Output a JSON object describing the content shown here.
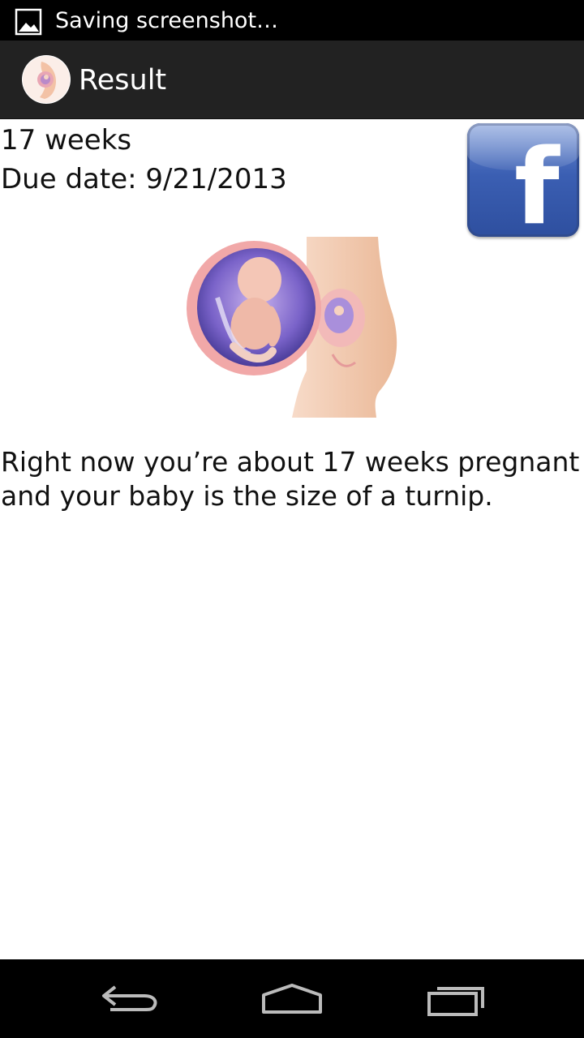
{
  "status_bar": {
    "notification_text": "Saving screenshot…",
    "notification_icon": "image-icon"
  },
  "action_bar": {
    "title": "Result",
    "app_icon": "pregnancy-app-icon"
  },
  "result": {
    "weeks": "17 weeks",
    "due_date": "Due date: 9/21/2013",
    "message": "Right now you’re about 17 weeks pregnant and your baby is the size of a turnip.",
    "facebook_letter": "f"
  },
  "nav_bar": {
    "back_icon": "back-icon",
    "home_icon": "home-icon",
    "recents_icon": "recent-apps-icon"
  },
  "colors": {
    "status_bar": "#000000",
    "action_bar": "#222222",
    "facebook_blue": "#3b5998",
    "text": "#111111"
  }
}
